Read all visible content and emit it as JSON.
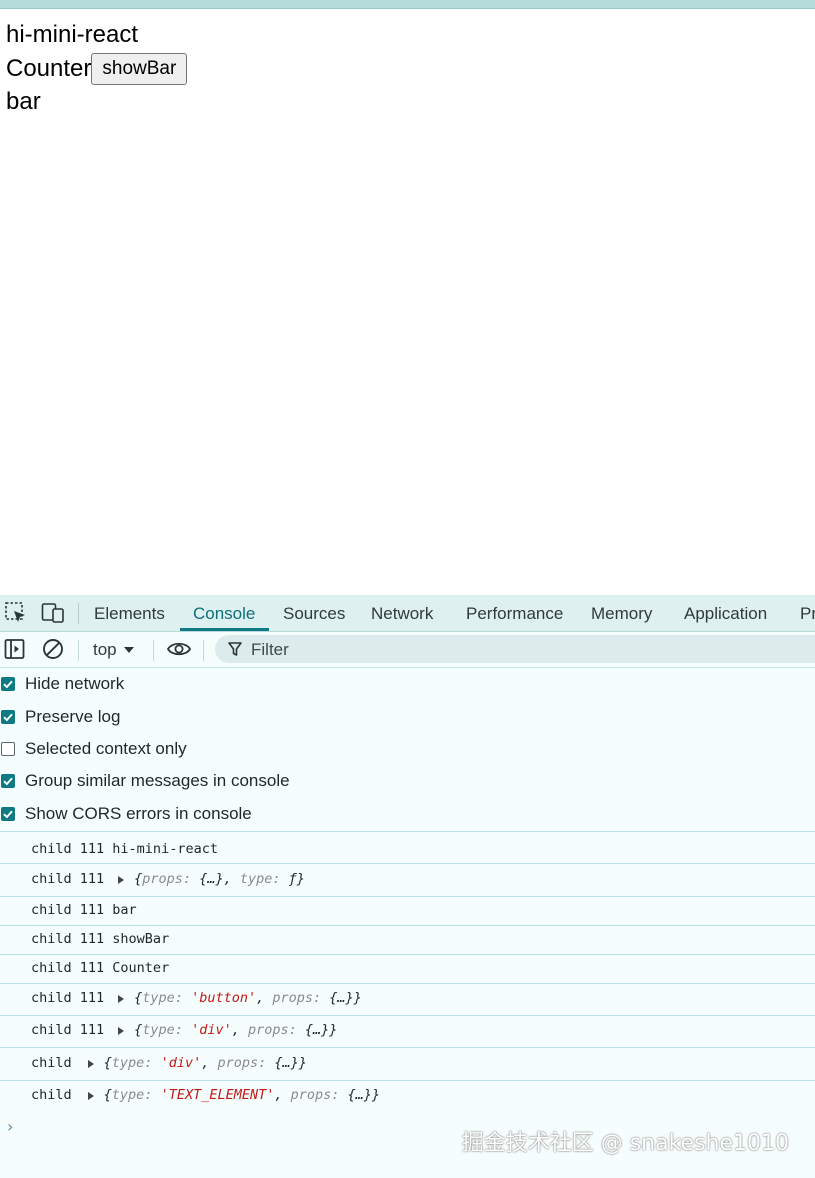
{
  "page": {
    "title_text": "hi-mini-react",
    "counter_label": "Counter",
    "show_bar_button": "showBar",
    "bar_text": "bar"
  },
  "devtools": {
    "tabs": [
      "Elements",
      "Console",
      "Sources",
      "Network",
      "Performance",
      "Memory",
      "Application",
      "Pr"
    ],
    "active_tab": "Console",
    "toolbar": {
      "context": "top",
      "filter_placeholder": "Filter"
    },
    "settings": [
      {
        "label": "Hide network",
        "checked": true
      },
      {
        "label": "Preserve log",
        "checked": true
      },
      {
        "label": "Selected context only",
        "checked": false
      },
      {
        "label": "Group similar messages in console",
        "checked": true
      },
      {
        "label": "Show CORS errors in console",
        "checked": true
      }
    ],
    "console": {
      "rows": [
        {
          "prefix": "child 111",
          "text": "hi-mini-react"
        },
        {
          "prefix": "child 111",
          "k1": "props",
          "v1": "{…}",
          "k2": "type",
          "v2": "ƒ"
        },
        {
          "prefix": "child 111",
          "text": "bar"
        },
        {
          "prefix": "child 111",
          "text": "showBar"
        },
        {
          "prefix": "child 111",
          "text": "Counter"
        },
        {
          "prefix": "child 111",
          "k1": "type",
          "v1": "'button'",
          "k2": "props",
          "v2": "{…}"
        },
        {
          "prefix": "child 111",
          "k1": "type",
          "v1": "'div'",
          "k2": "props",
          "v2": "{…}"
        },
        {
          "prefix": "child",
          "k1": "type",
          "v1": "'div'",
          "k2": "props",
          "v2": "{…}"
        },
        {
          "prefix": "child",
          "k1": "type",
          "v1": "'TEXT_ELEMENT'",
          "k2": "props",
          "v2": "{…}"
        }
      ],
      "prompt": "›"
    }
  },
  "watermark": "掘金技术社区 @ snakeshe1010",
  "colors": {
    "accent": "#0f7a84",
    "string": "#c41a16",
    "key": "#8b8b8b"
  }
}
